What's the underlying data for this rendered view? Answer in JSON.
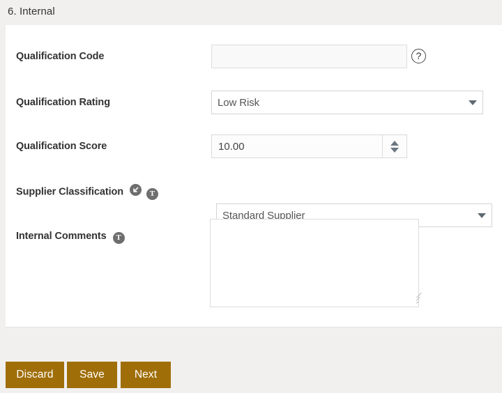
{
  "section": {
    "title": "6. Internal"
  },
  "fields": {
    "qualification_code": {
      "label": "Qualification Code",
      "value": "",
      "placeholder": "",
      "help_icon": "question-mark-icon",
      "help_glyph": "?"
    },
    "qualification_rating": {
      "label": "Qualification Rating",
      "value": "Low Risk",
      "dropdown_icon": "chevron-down-icon"
    },
    "qualification_score": {
      "label": "Qualification Score",
      "value": "10.00",
      "stepper_up_icon": "caret-up-icon",
      "stepper_down_icon": "caret-down-icon"
    },
    "supplier_classification": {
      "label": "Supplier Classification",
      "value": "Standard Supplier",
      "dropdown_icon": "chevron-down-icon",
      "badges": [
        {
          "name": "arrow-down-left-icon",
          "letter": ""
        },
        {
          "name": "translate-text-icon",
          "letter": "T"
        }
      ]
    },
    "internal_comments": {
      "label": "Internal Comments",
      "value": "",
      "placeholder": "",
      "badges": [
        {
          "name": "translate-text-icon",
          "letter": "T"
        }
      ]
    }
  },
  "footer": {
    "buttons": [
      {
        "name": "discard-button",
        "label": "Discard"
      },
      {
        "name": "save-button",
        "label": "Save"
      },
      {
        "name": "next-button",
        "label": "Next"
      }
    ]
  },
  "colors": {
    "button_background": "#a06e08",
    "page_background": "#f1f0ee",
    "panel_background": "#ffffff",
    "label_text": "#333333",
    "badge_background": "#6e6e6e"
  }
}
